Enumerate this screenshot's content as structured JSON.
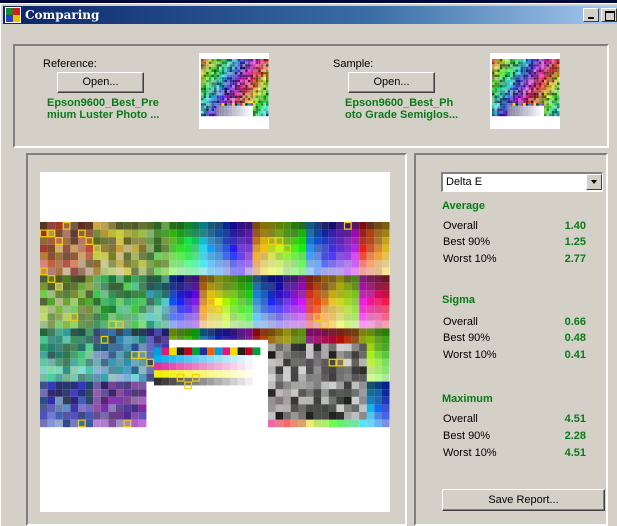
{
  "window": {
    "title": "Comparing"
  },
  "reference": {
    "label": "Reference:",
    "open_label": "Open...",
    "file_line1": "Epson9600_Best_Pre",
    "file_line2": "mium Luster Photo ..."
  },
  "sample": {
    "label": "Sample:",
    "open_label": "Open...",
    "file_line1": "Epson9600_Best_Ph",
    "file_line2": "oto Grade Semiglos..."
  },
  "metric_select": {
    "value": "Delta E"
  },
  "stats": {
    "average": {
      "title": "Average",
      "rows": [
        {
          "label": "Overall",
          "value": "1.40"
        },
        {
          "label": "Best 90%",
          "value": "1.25"
        },
        {
          "label": "Worst 10%",
          "value": "2.77"
        }
      ]
    },
    "sigma": {
      "title": "Sigma",
      "rows": [
        {
          "label": "Overall",
          "value": "0.66"
        },
        {
          "label": "Best 90%",
          "value": "0.48"
        },
        {
          "label": "Worst 10%",
          "value": "0.41"
        }
      ]
    },
    "maximum": {
      "title": "Maximum",
      "rows": [
        {
          "label": "Overall",
          "value": "4.51"
        },
        {
          "label": "Best 90%",
          "value": "2.28"
        },
        {
          "label": "Worst 10%",
          "value": "4.51"
        }
      ]
    }
  },
  "save_report_label": "Save Report...",
  "colors": {
    "accent_green": "#0a7a18",
    "highlight_yellow": "#f0d000",
    "title_blue": "#0a246a"
  },
  "icons": {
    "app": "color-chart-icon",
    "minimize": "minimize-icon",
    "maximize": "maximize-icon",
    "dropdown": "chevron-down-icon"
  }
}
